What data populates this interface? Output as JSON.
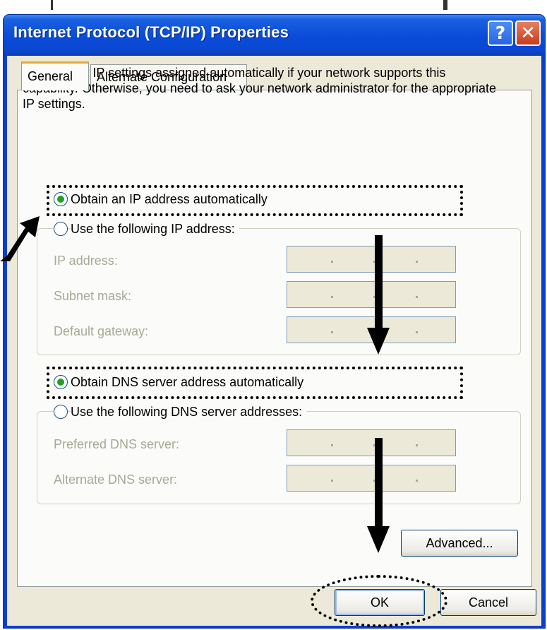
{
  "window": {
    "title": "Internet Protocol (TCP/IP) Properties",
    "help_label": "?",
    "close_label": "✕"
  },
  "tabs": [
    {
      "label": "General",
      "active": true
    },
    {
      "label": "Alternate Configuration",
      "active": false
    }
  ],
  "description": "You can get IP settings assigned automatically if your network supports this capability. Otherwise, you need to ask your network administrator for the appropriate IP settings.",
  "ip": {
    "auto_label": "Obtain an IP address automatically",
    "auto_selected": true,
    "manual_label": "Use the following IP address:",
    "fields": [
      {
        "label": "IP address:",
        "value": ". . ."
      },
      {
        "label": "Subnet mask:",
        "value": ". . ."
      },
      {
        "label": "Default gateway:",
        "value": ". . ."
      }
    ]
  },
  "dns": {
    "auto_label": "Obtain DNS server address automatically",
    "auto_selected": true,
    "manual_label": "Use the following DNS server addresses:",
    "fields": [
      {
        "label": "Preferred DNS server:",
        "value": ". . ."
      },
      {
        "label": "Alternate DNS server:",
        "value": ". . ."
      }
    ]
  },
  "buttons": {
    "advanced": "Advanced...",
    "ok": "OK",
    "cancel": "Cancel"
  },
  "colors": {
    "titlebar": "#0a48d2",
    "dialog_bg": "#ece9d8",
    "radio_dot": "#21a121",
    "disabled_text": "#a8a895"
  }
}
